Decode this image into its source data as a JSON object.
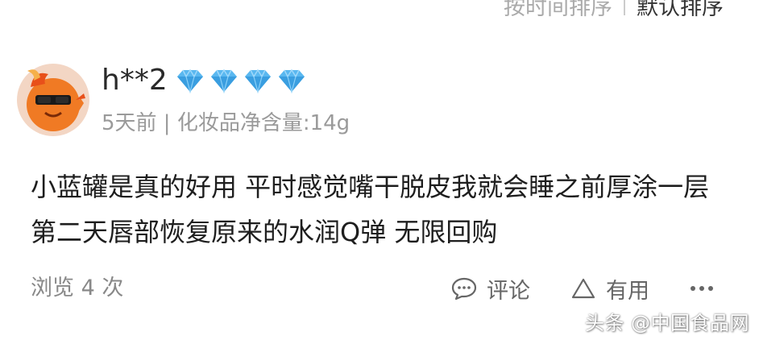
{
  "sort": {
    "by_time": "按时间排序",
    "by_default": "默认排序"
  },
  "review": {
    "username": "h**2",
    "diamond_count": 4,
    "meta": "5天前 | 化妆品净含量:14g",
    "content": "小蓝罐是真的好用 平时感觉嘴干脱皮我就会睡之前厚涂一层 第二天唇部恢复原来的水润Q弹 无限回购",
    "views": "浏览 4 次"
  },
  "actions": {
    "comment_label": "评论",
    "useful_label": "有用",
    "more_icon": "more-dots-icon"
  },
  "watermark": "头条 @中国食品网",
  "colors": {
    "diamond": "#5ab8f0",
    "avatar_orange": "#f07a24",
    "text_muted": "#9a9a9a"
  }
}
